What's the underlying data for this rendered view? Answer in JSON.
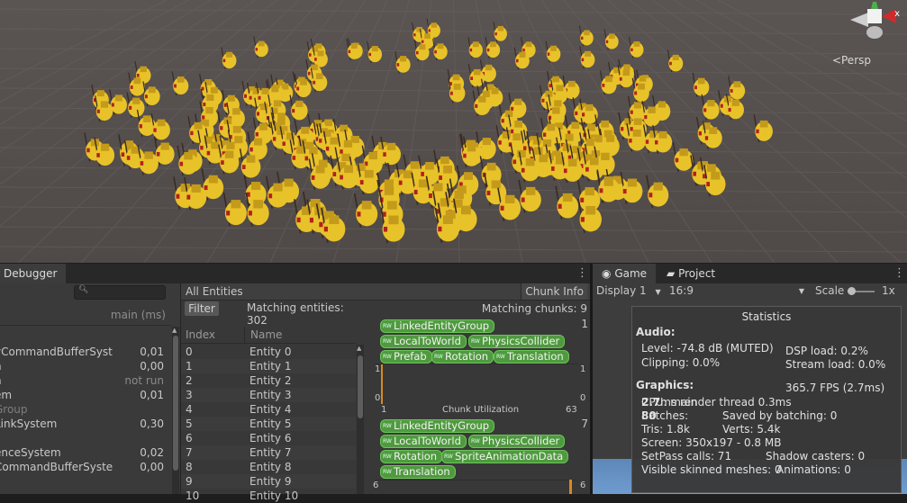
{
  "scene": {
    "persp_label": "Persp",
    "gizmo_x": "x",
    "colors": {
      "background": "#55504e",
      "crowd_body": "#e8c229",
      "crowd_shadow": "#c49a1a",
      "accent_red": "#b3201e"
    }
  },
  "entity_debugger": {
    "tab_label": "Debugger",
    "header_time": "main (ms)",
    "systems": [
      {
        "name": "",
        "time": ""
      },
      {
        "name": "yCommandBufferSyst",
        "time": "0,01"
      },
      {
        "name": "n",
        "time": "0,00"
      },
      {
        "name": "n",
        "time": "not run"
      },
      {
        "name": "em",
        "time": "0,01"
      },
      {
        "name": "Group",
        "time": ""
      },
      {
        "name": "LinkSystem",
        "time": "0,30"
      },
      {
        "name": "",
        "time": ""
      },
      {
        "name": "enceSystem",
        "time": "0,02"
      },
      {
        "name": "CommandBufferSyste",
        "time": "0,00"
      }
    ],
    "all_entities_label": "All Entities",
    "filter_label": "Filter",
    "matching_entities": "Matching entities: 302",
    "index_header": "Index",
    "name_header": "Name",
    "entities": [
      {
        "index": "0",
        "name": "Entity 0"
      },
      {
        "index": "1",
        "name": "Entity 1"
      },
      {
        "index": "2",
        "name": "Entity 2"
      },
      {
        "index": "3",
        "name": "Entity 3"
      },
      {
        "index": "4",
        "name": "Entity 4"
      },
      {
        "index": "5",
        "name": "Entity 5"
      },
      {
        "index": "6",
        "name": "Entity 6"
      },
      {
        "index": "7",
        "name": "Entity 7"
      },
      {
        "index": "8",
        "name": "Entity 8"
      },
      {
        "index": "9",
        "name": "Entity 9"
      },
      {
        "index": "10",
        "name": "Entity 10"
      }
    ],
    "chunk_info_button": "Chunk Info",
    "matching_chunks": "Matching chunks: 9",
    "chunk1": {
      "count": "1",
      "components": [
        "LinkedEntityGroup",
        "LocalToWorld",
        "PhysicsCollider",
        "Prefab",
        "Rotation",
        "Translation"
      ],
      "graph_left_top": "1",
      "graph_left_bottom": "0",
      "graph_right_top": "1",
      "graph_right_bottom": "0",
      "axis_left": "1",
      "axis_right": "63",
      "utilization_label": "Chunk Utilization"
    },
    "chunk2": {
      "count": "7",
      "components": [
        "LinkedEntityGroup",
        "LocalToWorld",
        "PhysicsCollider",
        "Rotation",
        "SpriteAnimationData",
        "Translation"
      ],
      "graph_left_top": "6",
      "graph_right_top": "6"
    }
  },
  "game": {
    "game_tab": "Game",
    "project_tab": "Project",
    "display": "Display 1",
    "aspect": "16:9",
    "scale_label": "Scale",
    "scale_value": "1x",
    "scale_fraction": 0.0,
    "statistics": {
      "title": "Statistics",
      "audio_heading": "Audio:",
      "level": "Level: -74.8 dB (MUTED)",
      "dsp_load": "DSP load: 0.2%",
      "clipping": "Clipping: 0.0%",
      "stream_load": "Stream load: 0.0%",
      "graphics_heading": "Graphics:",
      "fps": "365.7 FPS (2.7ms)",
      "cpu_prefix": "CPU: main ",
      "cpu_main": "2.7",
      "cpu_suffix": "ms  render thread 0.3ms",
      "batches_prefix": "Batches: ",
      "batches": "80",
      "saved_batching": "Saved by batching: 0",
      "tris": "Tris: 1.8k",
      "verts": "Verts: 5.4k",
      "screen": "Screen: 350x197 - 0.8 MB",
      "setpass": "SetPass calls: 71",
      "shadow_casters": "Shadow casters: 0",
      "skinned_meshes": "Visible skinned meshes: 0",
      "animations": "Animations: 0"
    }
  }
}
